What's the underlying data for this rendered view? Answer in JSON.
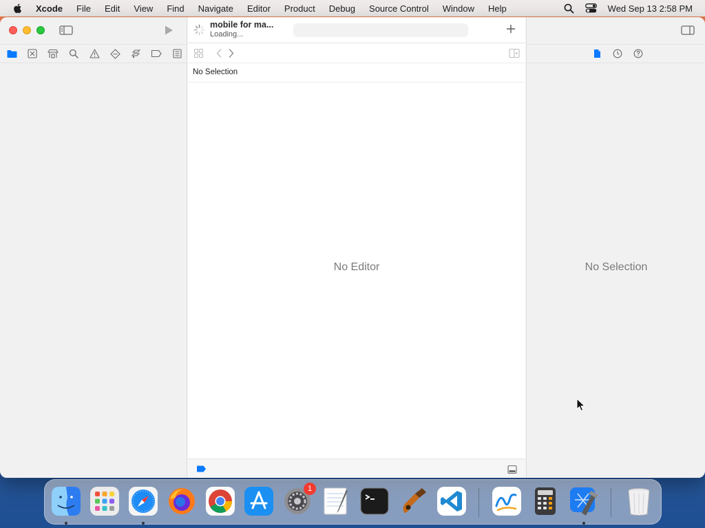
{
  "menubar": {
    "app_name": "Xcode",
    "menus": [
      "File",
      "Edit",
      "View",
      "Find",
      "Navigate",
      "Editor",
      "Product",
      "Debug",
      "Source Control",
      "Window",
      "Help"
    ],
    "clock": "Wed Sep 13  2:58 PM"
  },
  "toolbar": {
    "scheme_title": "mobile for ma...",
    "scheme_status": "Loading..."
  },
  "editor": {
    "path_label": "No Selection",
    "empty_label": "No Editor"
  },
  "inspector": {
    "empty_label": "No Selection"
  },
  "navigator_tabs": [
    "folder-icon",
    "source-control-icon",
    "symbol-icon",
    "find-icon",
    "issue-icon",
    "test-icon",
    "debug-icon",
    "breakpoint-icon",
    "report-icon"
  ],
  "inspector_tabs": [
    "file-inspector-icon",
    "history-icon",
    "help-icon"
  ],
  "dock": {
    "apps": [
      "Finder",
      "Launchpad",
      "Safari",
      "Firefox",
      "Chrome",
      "App Store",
      "System Settings",
      "TextEdit",
      "Terminal",
      "Instruments",
      "Visual Studio Code",
      "Freeform",
      "Calculator",
      "Xcode",
      "Trash"
    ],
    "settings_badge": "1"
  },
  "colors": {
    "close": "#ff5f57",
    "minimize": "#febc2e",
    "maximize": "#28c840",
    "accent": "#0a7aff"
  }
}
